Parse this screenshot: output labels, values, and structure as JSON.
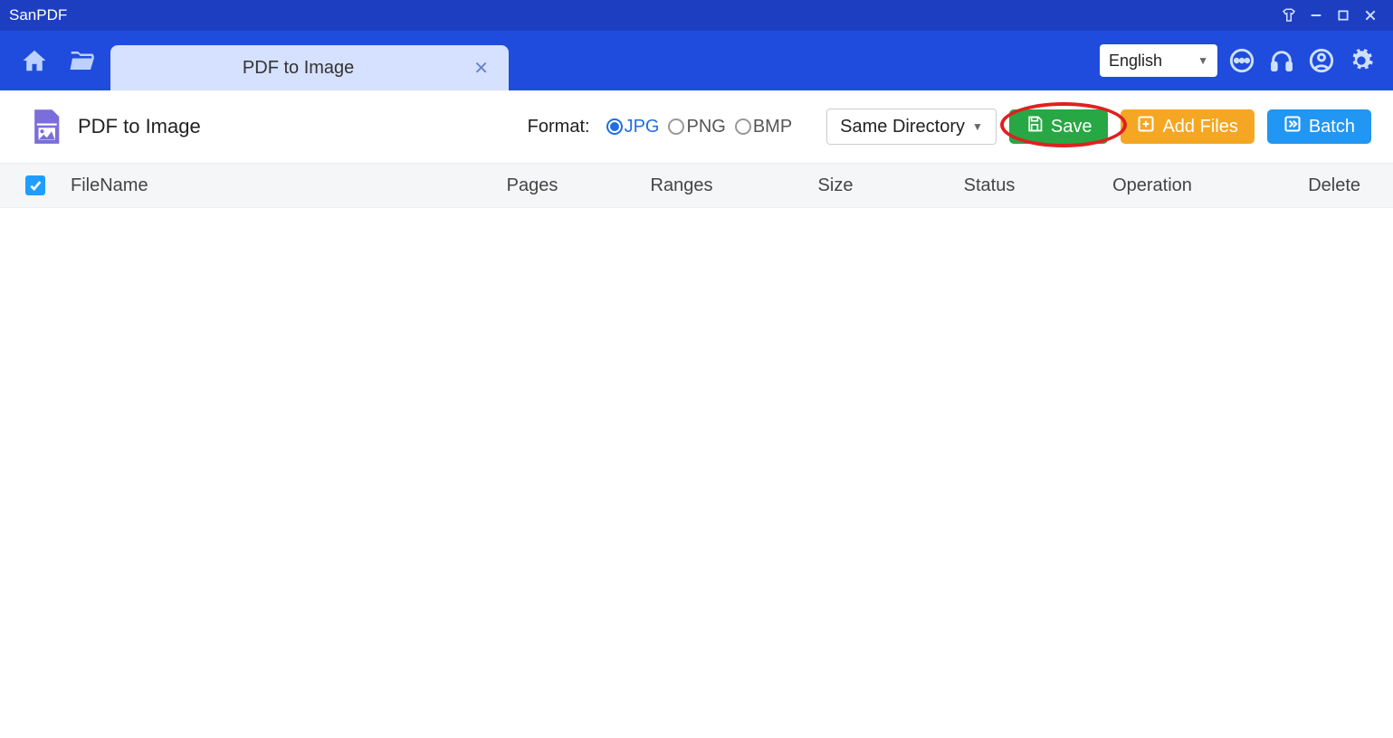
{
  "app": {
    "title": "SanPDF"
  },
  "toolbar": {
    "tab_label": "PDF to Image",
    "language": "English"
  },
  "page": {
    "title": "PDF to Image",
    "format_label": "Format:",
    "formats": {
      "jpg": "JPG",
      "png": "PNG",
      "bmp": "BMP"
    },
    "directory_label": "Same Directory",
    "save_label": "Save",
    "add_files_label": "Add Files",
    "batch_label": "Batch"
  },
  "table": {
    "headers": {
      "filename": "FileName",
      "pages": "Pages",
      "ranges": "Ranges",
      "size": "Size",
      "status": "Status",
      "operation": "Operation",
      "delete": "Delete"
    }
  }
}
